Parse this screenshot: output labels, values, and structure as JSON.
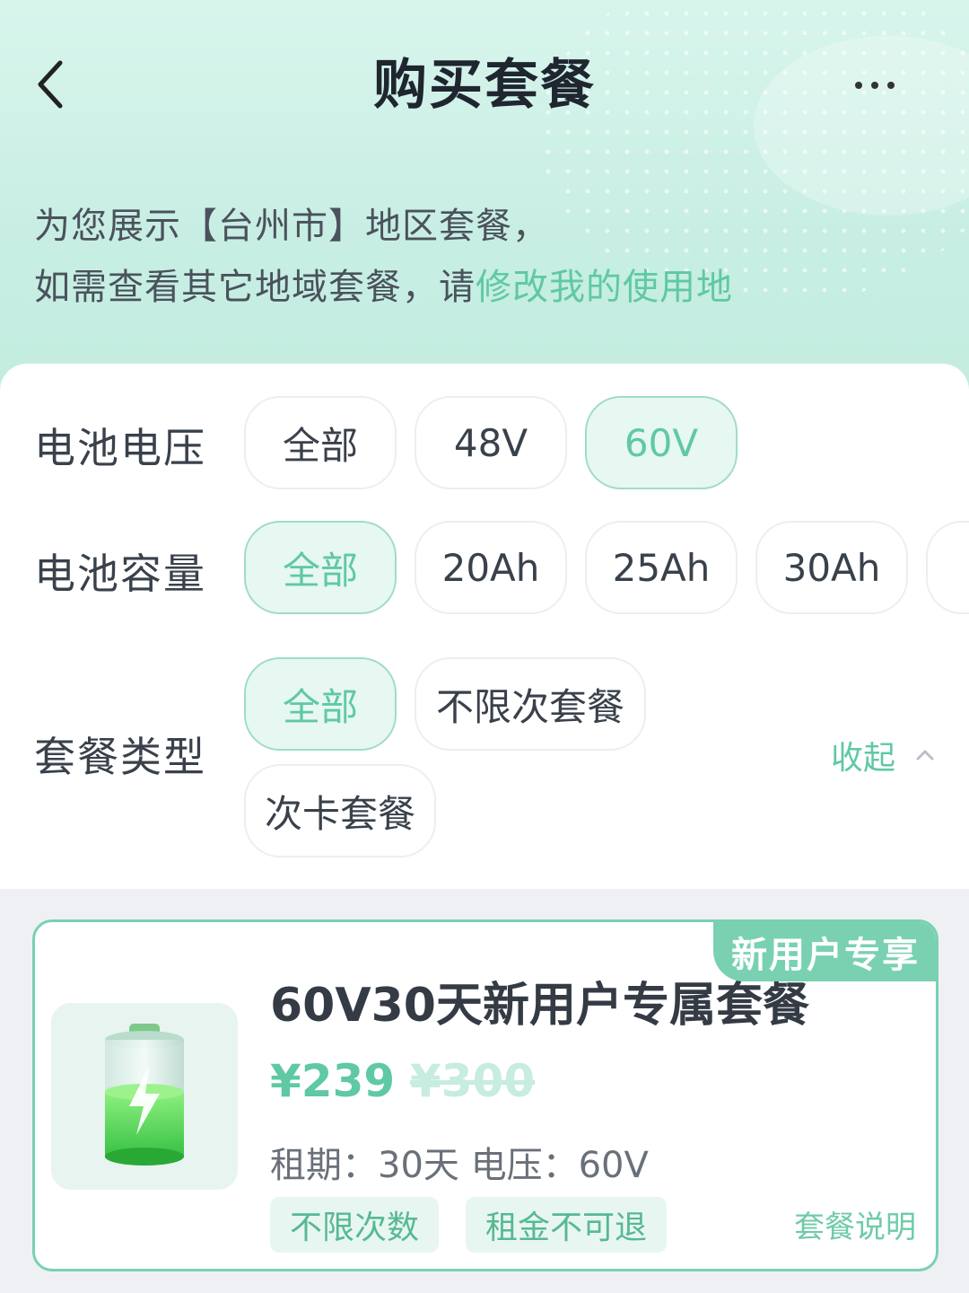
{
  "nav": {
    "title": "购买套餐"
  },
  "region": {
    "line1": "为您展示【台州市】地区套餐，",
    "line2_prefix": "如需查看其它地域套餐，请",
    "line2_link": "修改我的使用地"
  },
  "filters": {
    "voltage": {
      "label": "电池电压",
      "options": [
        "全部",
        "48V",
        "60V"
      ],
      "selected": "60V"
    },
    "capacity": {
      "label": "电池容量",
      "options": [
        "全部",
        "20Ah",
        "25Ah",
        "30Ah"
      ],
      "selected": "全部"
    },
    "package_type": {
      "label": "套餐类型",
      "options": [
        "全部",
        "不限次套餐",
        "次卡套餐"
      ],
      "selected": "全部"
    },
    "collapse_label": "收起"
  },
  "package_card": {
    "badge": "新用户专享",
    "title": "60V30天新用户专属套餐",
    "price": "¥239",
    "original_price": "¥300",
    "spec": "租期：30天  电压：60V",
    "tags": [
      "不限次数",
      "租金不可退"
    ],
    "detail_link": "套餐说明",
    "icon": "battery-charging-icon"
  },
  "colors": {
    "accent": "#5fc9a3",
    "accent_border": "#79d1b2",
    "chip_active_bg": "#e7f7f1",
    "text_dark": "#39414b"
  }
}
